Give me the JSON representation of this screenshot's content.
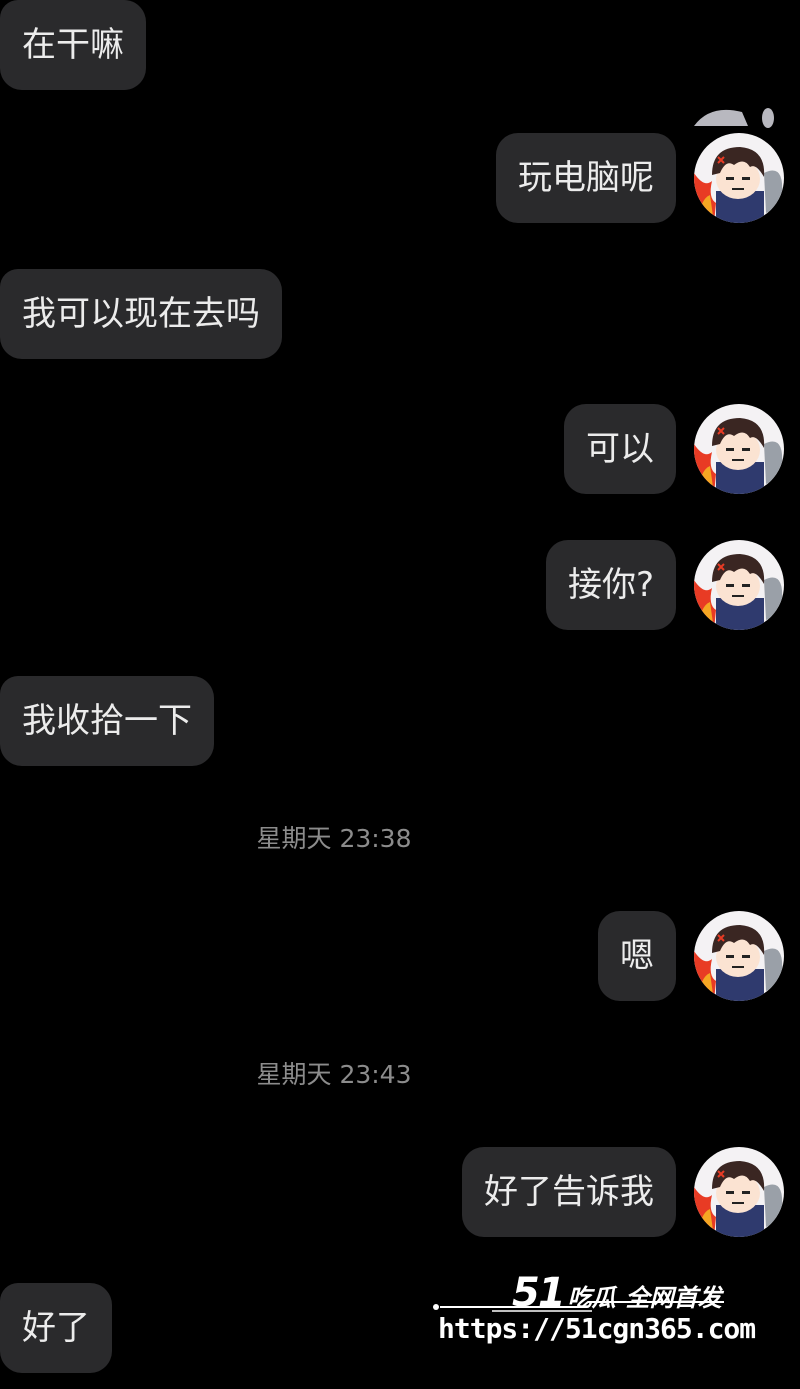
{
  "messages": [
    {
      "side": "left",
      "text": "在干嘛"
    },
    {
      "side": "right",
      "text": "玩电脑呢"
    },
    {
      "side": "left",
      "text": "我可以现在去吗"
    },
    {
      "side": "right",
      "text": "可以"
    },
    {
      "side": "right",
      "text": "接你?"
    },
    {
      "side": "left",
      "text": "我收拾一下"
    },
    {
      "side": "right",
      "text": "嗯"
    },
    {
      "side": "right",
      "text": "好了告诉我"
    },
    {
      "side": "left",
      "text": "好了"
    }
  ],
  "timestamps": [
    "星期天 23:38",
    "星期天 23:43"
  ],
  "avatar": {
    "icon": "cartoon-avatar-icon",
    "bg": "#f4f2f4",
    "hair": "#3a2622",
    "flame": "#e83b24",
    "coat": "#2f3a6e"
  },
  "watermark": {
    "num": "51",
    "name": "吃瓜",
    "slogan": "全网首发",
    "url": "https://51cgn365.com"
  },
  "colors": {
    "background": "#000000",
    "bubble": "#2a2a2c",
    "text": "#ececec",
    "timestamp": "#8c8c8c"
  }
}
